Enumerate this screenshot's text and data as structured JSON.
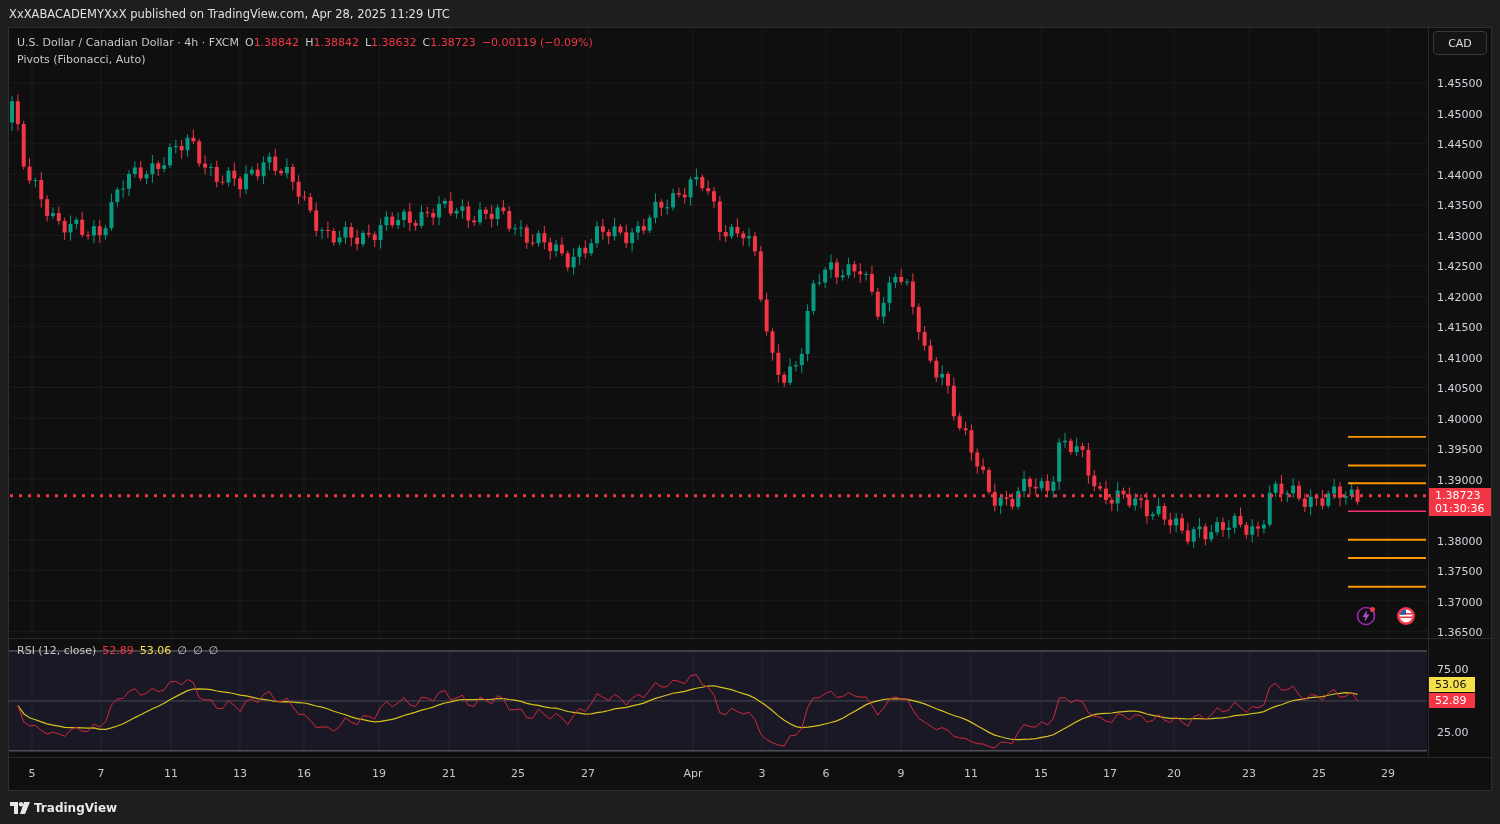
{
  "header": {
    "publisher_line": "XxXABACADEMYXxX published on TradingView.com, Apr 28, 2025 11:29 UTC"
  },
  "legend": {
    "symbol": "U.S. Dollar / Canadian Dollar · 4h · FXCM",
    "ohlc": [
      {
        "label": "O",
        "value": "1.38842"
      },
      {
        "label": "H",
        "value": "1.38842"
      },
      {
        "label": "L",
        "value": "1.38632"
      },
      {
        "label": "C",
        "value": "1.38723"
      }
    ],
    "change": "−0.00119 (−0.09%)",
    "indicator": "Pivots (Fibonacci, Auto)"
  },
  "currency_button": "CAD",
  "price_axis": [
    "1.45500",
    "1.45000",
    "1.44500",
    "1.44000",
    "1.43500",
    "1.43000",
    "1.42500",
    "1.42000",
    "1.41500",
    "1.41000",
    "1.40500",
    "1.40000",
    "1.39500",
    "1.39000",
    "1.38000",
    "1.37500",
    "1.37000",
    "1.36500"
  ],
  "last_price": "1.38723",
  "countdown": "01:30:36",
  "rsi": {
    "title": "RSI (12, close)",
    "value": "52.89",
    "ma_value": "53.06",
    "extras": [
      "∅",
      "∅",
      "∅"
    ],
    "axis": [
      "75.00",
      "25.00"
    ],
    "ma_tag": "53.06",
    "value_tag": "52.89"
  },
  "time_axis": [
    "5",
    "7",
    "11",
    "13",
    "16",
    "19",
    "21",
    "25",
    "27",
    "Apr",
    "3",
    "6",
    "9",
    "11",
    "15",
    "17",
    "20",
    "23",
    "25",
    "29"
  ],
  "footer": {
    "logo_text": "TradingView"
  }
}
